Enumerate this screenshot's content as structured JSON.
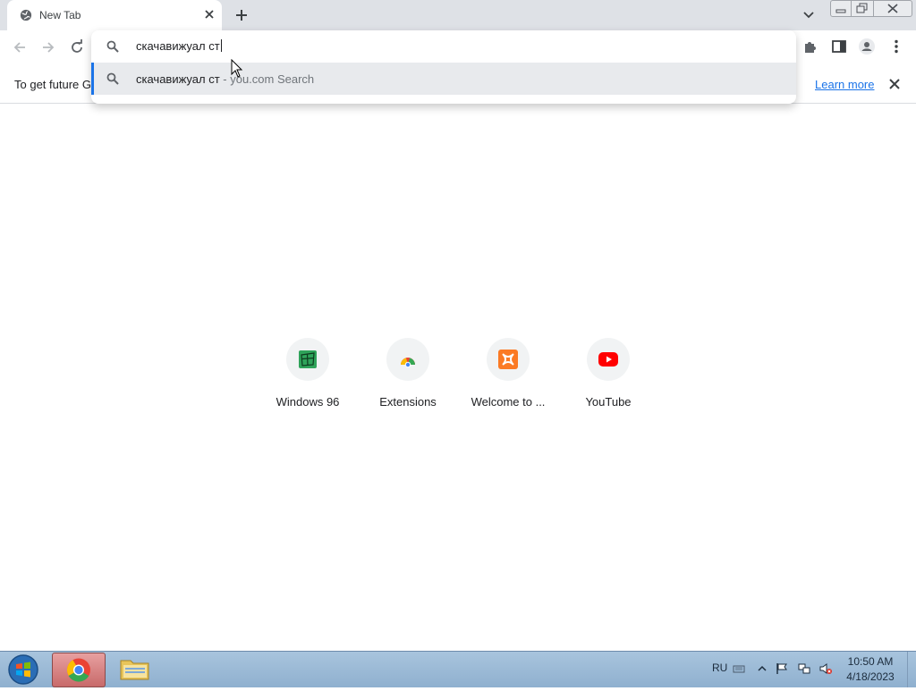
{
  "tab": {
    "title": "New Tab"
  },
  "omnibox": {
    "input_text": "скачавижуал ст",
    "suggestion_text": "скачавижуал ст",
    "suggestion_suffix": " - you.com Search"
  },
  "infobar": {
    "text": "To get future G",
    "learn_more": "Learn more"
  },
  "shortcuts": [
    {
      "label": "Windows 96",
      "icon": "windows96-icon"
    },
    {
      "label": "Extensions",
      "icon": "chrome-extensions-icon"
    },
    {
      "label": "Welcome to ...",
      "icon": "xampp-icon"
    },
    {
      "label": "YouTube",
      "icon": "youtube-icon"
    }
  ],
  "taskbar": {
    "language": "RU",
    "time": "10:50 AM",
    "date": "4/18/2023"
  },
  "colors": {
    "accent": "#1a73e8",
    "youtube": "#ff0000",
    "xampp": "#fb7a24",
    "win96": "#2fa35a"
  }
}
